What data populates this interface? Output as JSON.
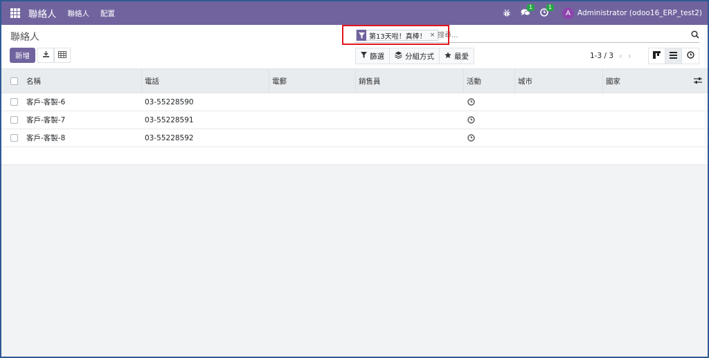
{
  "navbar": {
    "app_name": "聯絡人",
    "menu": [
      "聯絡人",
      "配置"
    ],
    "messages_count": "1",
    "activities_count": "1",
    "user_initial": "A",
    "user_name": "Administrator (odoo16_ERP_test2)",
    "bg_color": "#71639e"
  },
  "control_panel": {
    "title": "聯絡人",
    "new_label": "新增",
    "search": {
      "facet_label": "第13天啦！真棒！",
      "facet_close": "×",
      "placeholder": "搜尋..."
    },
    "filters": {
      "filter_label": "篩選",
      "group_label": "分組方式",
      "favorites_label": "最愛"
    },
    "pager": {
      "value": "1-3 / 3",
      "prev": "‹",
      "next": "›"
    }
  },
  "list": {
    "columns": [
      "名稱",
      "電話",
      "電郵",
      "銷售員",
      "活動",
      "城市",
      "國家"
    ],
    "rows": [
      {
        "name": "客戶-客製-6",
        "phone": "03-55228590"
      },
      {
        "name": "客戶-客製-7",
        "phone": "03-55228591"
      },
      {
        "name": "客戶-客製-8",
        "phone": "03-55228592"
      }
    ]
  },
  "icons": {
    "apps": "apps-grid-icon",
    "bug": "bug-icon",
    "messages": "chat-icon",
    "activities": "clock-icon",
    "filter": "filter-icon",
    "group": "layers-icon",
    "favorite": "star-icon",
    "search": "search-icon",
    "download": "download-icon",
    "spreadsheet": "table-icon",
    "kanban": "kanban-icon",
    "list": "list-icon",
    "activity_view": "clock-icon",
    "optional_columns": "sliders-icon"
  },
  "accent_colors": {
    "brand": "#71639e",
    "badge": "#28a745",
    "highlight": "#e3141b"
  }
}
